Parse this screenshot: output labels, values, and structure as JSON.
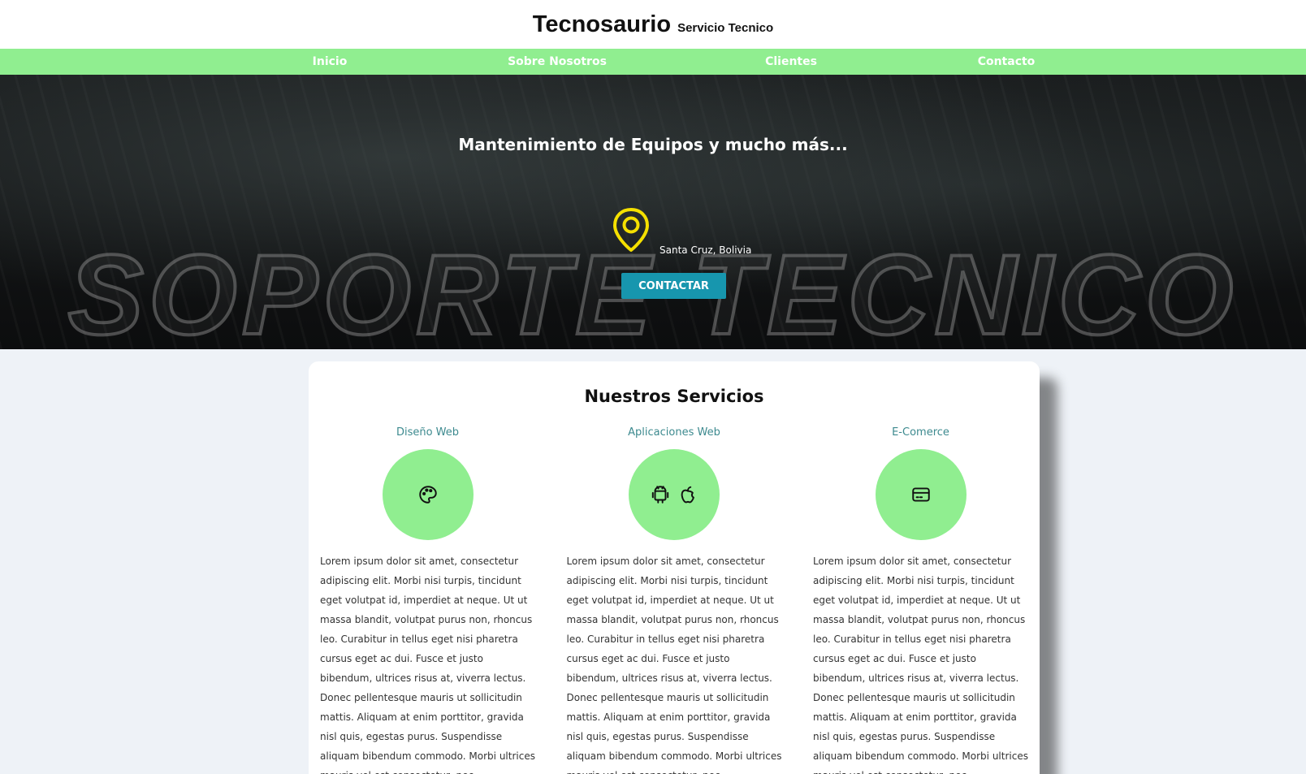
{
  "header": {
    "title": "Tecnosaurio",
    "subtitle": "Servicio Tecnico"
  },
  "nav": {
    "items": [
      {
        "label": "Inicio"
      },
      {
        "label": "Sobre Nosotros"
      },
      {
        "label": "Clientes"
      },
      {
        "label": "Contacto"
      }
    ]
  },
  "hero": {
    "title": "Mantenimiento de Equipos y mucho más...",
    "location_icon": "map-pin-icon",
    "location": "Santa Cruz, Bolivia",
    "button_label": "CONTACTAR",
    "watermark": "SOPORTE TECNICO"
  },
  "services": {
    "title": "Nuestros Servicios",
    "items": [
      {
        "name": "Diseño Web",
        "icons": [
          "palette-icon"
        ],
        "text": "Lorem ipsum dolor sit amet, consectetur adipiscing elit. Morbi nisi turpis, tincidunt eget volutpat id, imperdiet at neque. Ut ut massa blandit, volutpat purus non, rhoncus leo. Curabitur in tellus eget nisi pharetra cursus eget ac dui. Fusce et justo bibendum, ultrices risus at, viverra lectus. Donec pellentesque mauris ut sollicitudin mattis. Aliquam at enim porttitor, gravida nisl quis, egestas purus. Suspendisse aliquam bibendum commodo. Morbi ultrices mauris vel est consectetur, nec"
      },
      {
        "name": "Aplicaciones Web",
        "icons": [
          "android-icon",
          "apple-icon"
        ],
        "text": "Lorem ipsum dolor sit amet, consectetur adipiscing elit. Morbi nisi turpis, tincidunt eget volutpat id, imperdiet at neque. Ut ut massa blandit, volutpat purus non, rhoncus leo. Curabitur in tellus eget nisi pharetra cursus eget ac dui. Fusce et justo bibendum, ultrices risus at, viverra lectus. Donec pellentesque mauris ut sollicitudin mattis. Aliquam at enim porttitor, gravida nisl quis, egestas purus. Suspendisse aliquam bibendum commodo. Morbi ultrices mauris vel est consectetur, nec"
      },
      {
        "name": "E-Comerce",
        "icons": [
          "credit-card-icon"
        ],
        "text": "Lorem ipsum dolor sit amet, consectetur adipiscing elit. Morbi nisi turpis, tincidunt eget volutpat id, imperdiet at neque. Ut ut massa blandit, volutpat purus non, rhoncus leo. Curabitur in tellus eget nisi pharetra cursus eget ac dui. Fusce et justo bibendum, ultrices risus at, viverra lectus. Donec pellentesque mauris ut sollicitudin mattis. Aliquam at enim porttitor, gravida nisl quis, egestas purus. Suspendisse aliquam bibendum commodo. Morbi ultrices mauris vel est consectetur, nec"
      }
    ]
  },
  "colors": {
    "nav_bg": "#90ee90",
    "circle_bg": "#90ee90",
    "button_bg": "#1796ae",
    "pin": "#f5e000",
    "service_name": "#3d8a8f"
  }
}
